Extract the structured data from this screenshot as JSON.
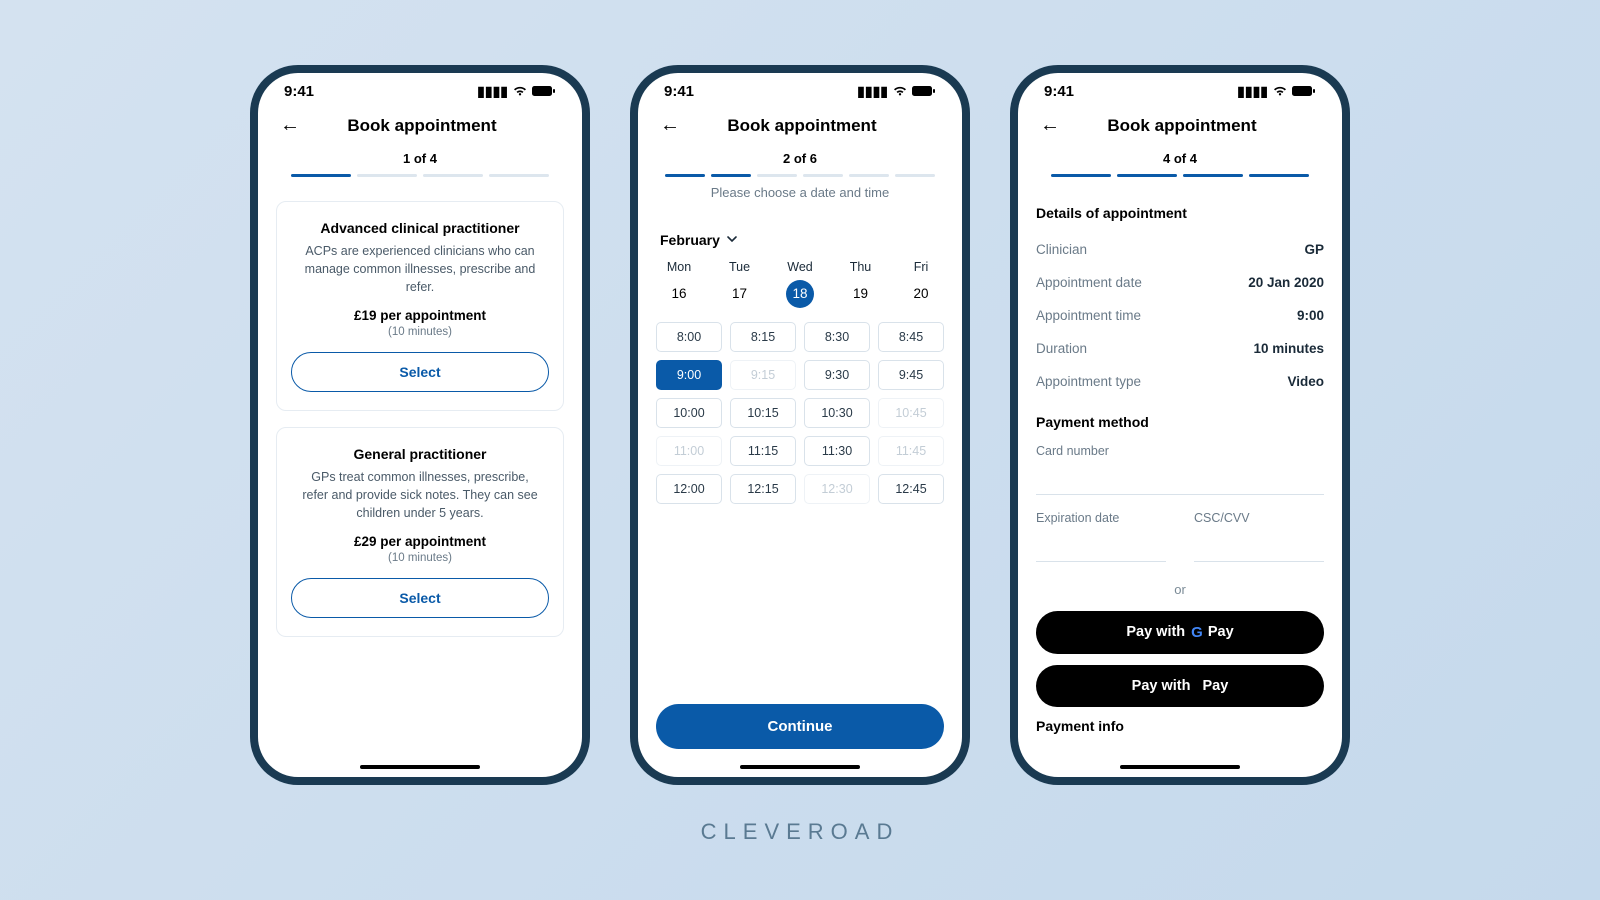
{
  "status": {
    "time": "9:41"
  },
  "screen1": {
    "title": "Book appointment",
    "step": "1 of 4",
    "bars": 4,
    "active_bars": 1,
    "cards": [
      {
        "title": "Advanced clinical practitioner",
        "desc": "ACPs are experienced clinicians who can manage common illnesses, prescribe and refer.",
        "price": "£19 per appointment",
        "duration": "(10 minutes)",
        "button": "Select"
      },
      {
        "title": "General practitioner",
        "desc": "GPs treat common illnesses, prescribe, refer and provide sick notes. They can see children under 5 years.",
        "price": "£29 per appointment",
        "duration": "(10 minutes)",
        "button": "Select"
      }
    ]
  },
  "screen2": {
    "title": "Book appointment",
    "step": "2 of 6",
    "bars": 6,
    "active_bars": 2,
    "hint": "Please choose a date and time",
    "month": "February",
    "days": [
      {
        "name": "Mon",
        "num": "16"
      },
      {
        "name": "Tue",
        "num": "17"
      },
      {
        "name": "Wed",
        "num": "18",
        "selected": true
      },
      {
        "name": "Thu",
        "num": "19"
      },
      {
        "name": "Fri",
        "num": "20"
      }
    ],
    "slots": [
      {
        "t": "8:00"
      },
      {
        "t": "8:15"
      },
      {
        "t": "8:30"
      },
      {
        "t": "8:45"
      },
      {
        "t": "9:00",
        "selected": true
      },
      {
        "t": "9:15",
        "disabled": true
      },
      {
        "t": "9:30"
      },
      {
        "t": "9:45"
      },
      {
        "t": "10:00"
      },
      {
        "t": "10:15"
      },
      {
        "t": "10:30"
      },
      {
        "t": "10:45",
        "disabled": true
      },
      {
        "t": "11:00",
        "disabled": true
      },
      {
        "t": "11:15"
      },
      {
        "t": "11:30"
      },
      {
        "t": "11:45",
        "disabled": true
      },
      {
        "t": "12:00"
      },
      {
        "t": "12:15"
      },
      {
        "t": "12:30",
        "disabled": true
      },
      {
        "t": "12:45"
      }
    ],
    "continue": "Continue"
  },
  "screen3": {
    "title": "Book appointment",
    "step": "4 of 4",
    "bars": 4,
    "active_bars": 4,
    "details_title": "Details of appointment",
    "rows": [
      {
        "lab": "Clinician",
        "val": "GP"
      },
      {
        "lab": "Appointment date",
        "val": "20 Jan 2020"
      },
      {
        "lab": "Appointment time",
        "val": "9:00"
      },
      {
        "lab": "Duration",
        "val": "10 minutes"
      },
      {
        "lab": "Appointment type",
        "val": "Video"
      }
    ],
    "payment_method_title": "Payment method",
    "card_number_label": "Card number",
    "exp_label": "Expiration date",
    "cvv_label": "CSC/CVV",
    "or": "or",
    "gpay_prefix": "Pay with",
    "gpay_suffix": "Pay",
    "apple_prefix": "Pay with",
    "apple_suffix": "Pay",
    "payment_info_title": "Payment info"
  },
  "brand": "CLEVEROAD"
}
